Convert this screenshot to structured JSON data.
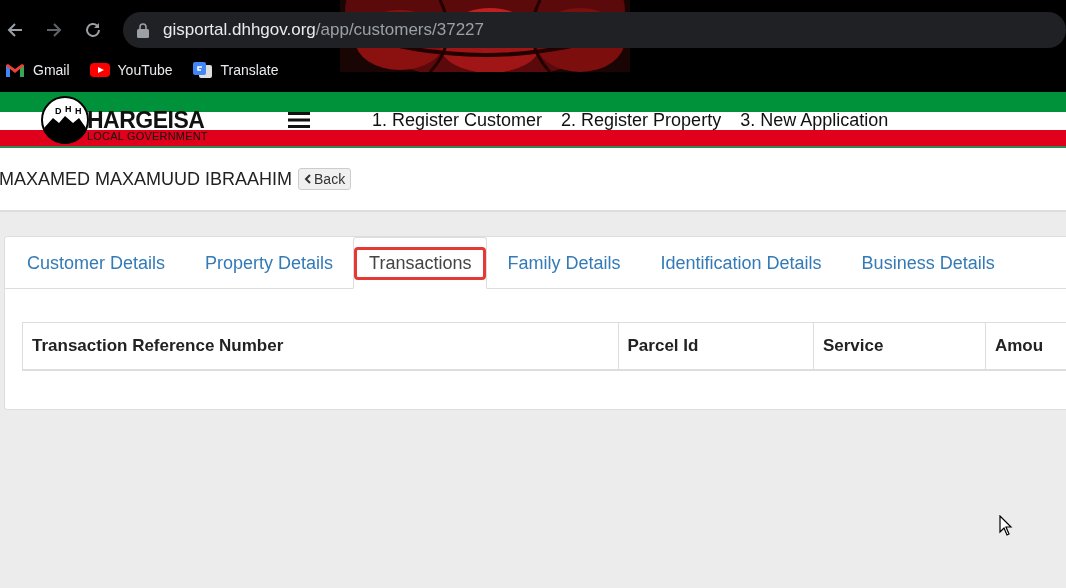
{
  "browser": {
    "url_host": "gisportal.dhhgov.org",
    "url_path": "/app/customers/37227",
    "bookmarks": [
      {
        "label": "Gmail",
        "kind": "gmail"
      },
      {
        "label": "YouTube",
        "kind": "youtube"
      },
      {
        "label": "Translate",
        "kind": "translate"
      }
    ]
  },
  "header": {
    "logo_letters": [
      "D",
      "H",
      "H"
    ],
    "logo_title": "HARGEISA",
    "logo_subtitle": "LOCAL GOVERNMENT",
    "nav_links": [
      "1. Register Customer",
      "2. Register Property",
      "3. New Application"
    ]
  },
  "customer": {
    "name": "MAXAMED MAXAMUUD IBRAAHIM",
    "back_button": "Back"
  },
  "tabs": [
    {
      "label": "Customer Details",
      "selected": false
    },
    {
      "label": "Property Details",
      "selected": false
    },
    {
      "label": "Transactions",
      "selected": true
    },
    {
      "label": "Family Details",
      "selected": false
    },
    {
      "label": "Identification Details",
      "selected": false
    },
    {
      "label": "Business Details",
      "selected": false
    }
  ],
  "table": {
    "columns": [
      "Transaction Reference Number",
      "Parcel Id",
      "Service",
      "Amou"
    ]
  }
}
